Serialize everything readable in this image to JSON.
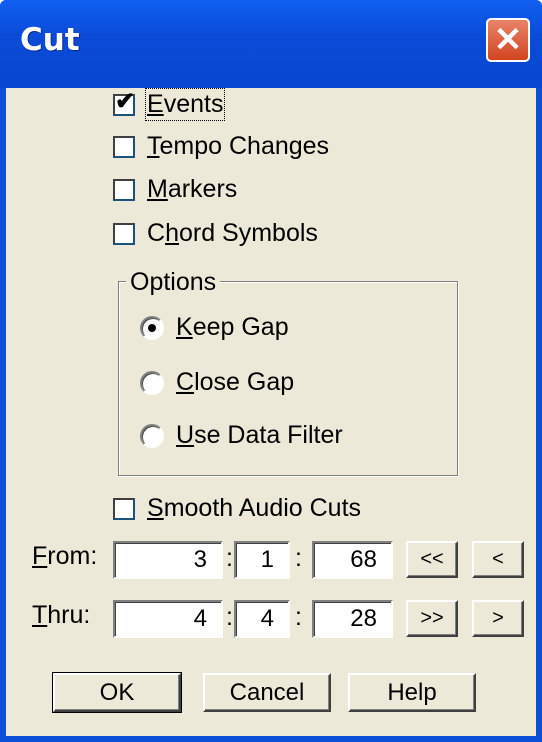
{
  "window": {
    "title": "Cut",
    "close_glyph": "✕"
  },
  "checkboxes": {
    "events": {
      "pre": "",
      "key": "E",
      "post": "vents",
      "checked": true
    },
    "tempo_changes": {
      "pre": "",
      "key": "T",
      "post": "empo Changes",
      "checked": false
    },
    "markers": {
      "pre": "",
      "key": "M",
      "post": "arkers",
      "checked": false
    },
    "chord_symbols": {
      "pre": "C",
      "key": "h",
      "post": "ord Symbols",
      "checked": false
    },
    "smooth_audio_cuts": {
      "pre": "",
      "key": "S",
      "post": "mooth Audio Cuts",
      "checked": false
    }
  },
  "options": {
    "legend": "Options",
    "keep_gap": {
      "pre": "",
      "key": "K",
      "post": "eep Gap",
      "selected": true
    },
    "close_gap": {
      "pre": "",
      "key": "C",
      "post": "lose Gap",
      "selected": false
    },
    "use_data_filter": {
      "pre": "",
      "key": "U",
      "post": "se Data Filter",
      "selected": false
    }
  },
  "range": {
    "from": {
      "key": "F",
      "post": "rom:",
      "bar": "3",
      "beat": "1",
      "tick": "68"
    },
    "thru": {
      "key": "T",
      "post": "hru:",
      "bar": "4",
      "beat": "4",
      "tick": "28"
    },
    "separator": ":"
  },
  "nav_buttons": {
    "first": "<<",
    "prev": "<",
    "last": ">>",
    "next": ">"
  },
  "buttons": {
    "ok": "OK",
    "cancel": "Cancel",
    "help": "Help"
  },
  "colors": {
    "titlebar": "#0a4fd6",
    "client_bg": "#ece9d8",
    "close_button": "#d2451f"
  }
}
